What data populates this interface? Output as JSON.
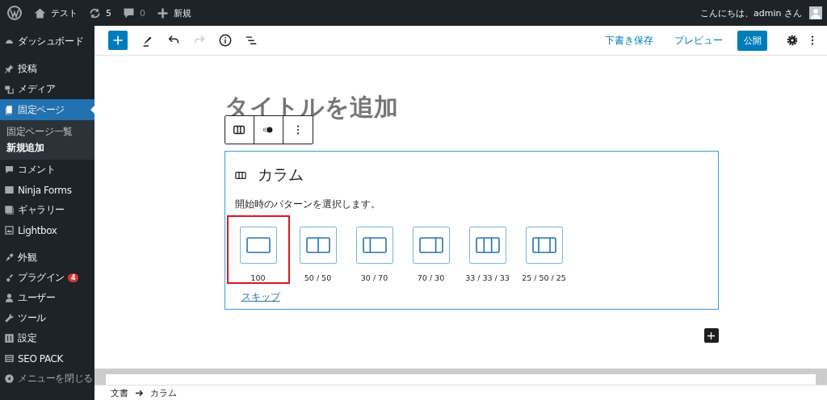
{
  "admin_bar": {
    "site_name": "テスト",
    "updates": "5",
    "comments": "0",
    "new_label": "新規",
    "greeting": "こんにちは、admin さん"
  },
  "sidebar": {
    "groups": [
      {
        "items": [
          {
            "label": "ダッシュボード",
            "selected": false
          }
        ]
      },
      {
        "items": [
          {
            "label": "投稿",
            "selected": false
          },
          {
            "label": "メディア",
            "selected": false
          },
          {
            "label": "固定ページ",
            "selected": true,
            "children": [
              {
                "label": "固定ページ一覧",
                "selected": false
              },
              {
                "label": "新規追加",
                "selected": true
              }
            ]
          },
          {
            "label": "コメント",
            "selected": false
          },
          {
            "label": "Ninja Forms",
            "selected": false
          },
          {
            "label": "ギャラリー",
            "selected": false
          },
          {
            "label": "Lightbox",
            "selected": false
          }
        ]
      },
      {
        "items": [
          {
            "label": "外観",
            "selected": false
          },
          {
            "label": "プラグイン",
            "selected": false,
            "badge": "4"
          },
          {
            "label": "ユーザー",
            "selected": false
          },
          {
            "label": "ツール",
            "selected": false
          },
          {
            "label": "設定",
            "selected": false
          },
          {
            "label": "SEO PACK",
            "selected": false
          }
        ]
      }
    ],
    "collapse_label": "メニューを閉じる"
  },
  "editor_header": {
    "redo_disabled": true,
    "save_draft": "下書き保存",
    "preview": "プレビュー",
    "publish": "公開"
  },
  "editor": {
    "title_placeholder": "タイトルを追加",
    "columns_block": {
      "title": "カラム",
      "instructions": "開始時のパターンを選択します。",
      "patterns": [
        {
          "label": "100",
          "highlighted": true
        },
        {
          "label": "50 / 50",
          "highlighted": false
        },
        {
          "label": "30 / 70",
          "highlighted": false
        },
        {
          "label": "70 / 30",
          "highlighted": false
        },
        {
          "label": "33 / 33 / 33",
          "highlighted": false
        },
        {
          "label": "25 / 50 / 25",
          "highlighted": false
        }
      ],
      "skip_link": "スキップ"
    }
  },
  "breadcrumb": [
    "文書",
    "カラム"
  ]
}
